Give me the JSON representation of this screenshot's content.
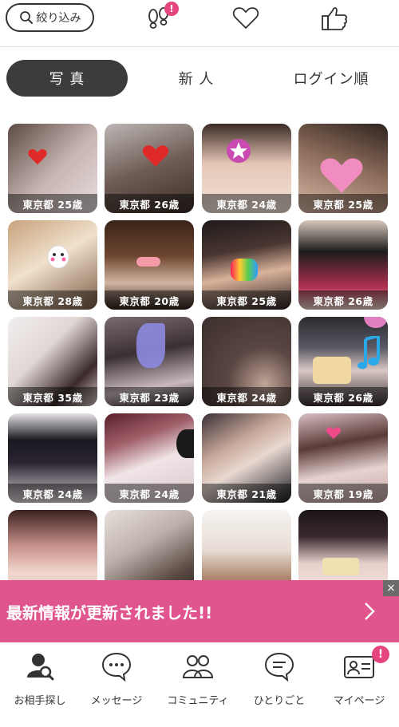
{
  "header": {
    "filter_label": "絞り込み",
    "footprint_badge": "!",
    "icons": [
      "search-icon",
      "footprint-icon",
      "heart-icon",
      "thumbs-up-icon"
    ]
  },
  "tabs": [
    {
      "label": "写 真",
      "active": true
    },
    {
      "label": "新 人",
      "active": false
    },
    {
      "label": "ログイン順",
      "active": false
    }
  ],
  "profiles": [
    {
      "label": "東京都 25歳"
    },
    {
      "label": "東京都 26歳"
    },
    {
      "label": "東京都 24歳"
    },
    {
      "label": "東京都 25歳"
    },
    {
      "label": "東京都 28歳"
    },
    {
      "label": "東京都 20歳"
    },
    {
      "label": "東京都 25歳"
    },
    {
      "label": "東京都 26歳"
    },
    {
      "label": "東京都 35歳"
    },
    {
      "label": "東京都 23歳"
    },
    {
      "label": "東京都 24歳"
    },
    {
      "label": "東京都 26歳"
    },
    {
      "label": "東京都 24歳"
    },
    {
      "label": "東京都 24歳"
    },
    {
      "label": "東京都 21歳"
    },
    {
      "label": "東京都 19歳"
    },
    {
      "label": ""
    },
    {
      "label": ""
    },
    {
      "label": ""
    },
    {
      "label": ""
    }
  ],
  "banner": {
    "text": "最新情報が更新されました!!",
    "close": "×",
    "color": "#e0558d"
  },
  "bottom_nav": [
    {
      "label": "お相手探し",
      "icon": "person-search-icon"
    },
    {
      "label": "メッセージ",
      "icon": "chat-bubble-icon"
    },
    {
      "label": "コミュニティ",
      "icon": "community-icon"
    },
    {
      "label": "ひとりごと",
      "icon": "monologue-icon"
    },
    {
      "label": "マイページ",
      "icon": "profile-card-icon",
      "badge": "!"
    }
  ],
  "colors": {
    "accent": "#e4457e",
    "active_tab": "#3c3c3c"
  }
}
